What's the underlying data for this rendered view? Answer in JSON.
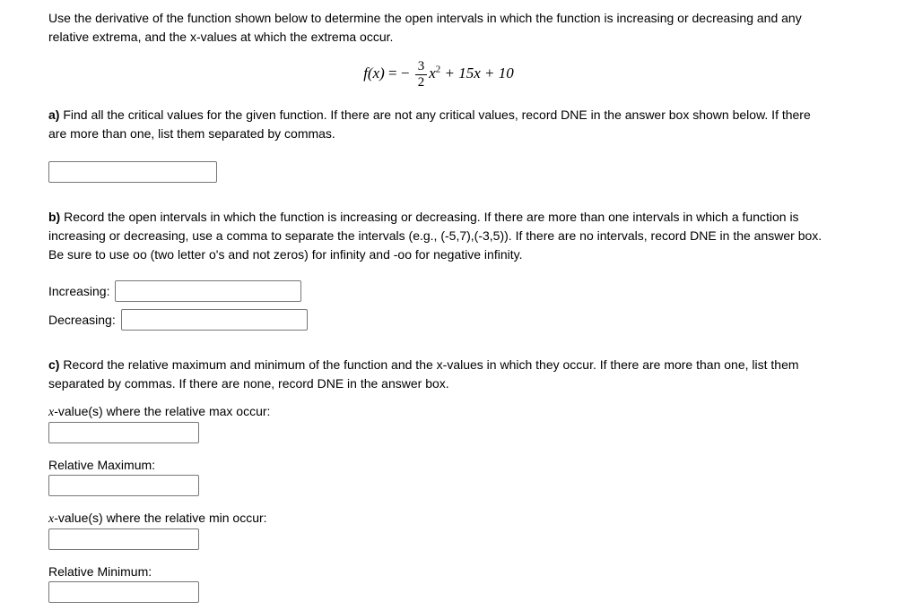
{
  "intro": "Use the derivative of the function shown below to determine the open intervals in which the function is increasing or decreasing and any relative extrema, and the x-values at which the extrema occur.",
  "formula": {
    "lhs": "f(x)",
    "equals": " = ",
    "minus": " − ",
    "frac_num": "3",
    "frac_den": "2",
    "x2": "x",
    "sup": "2",
    "tail": " + 15x + 10"
  },
  "parts": {
    "a": {
      "label": "a)",
      "text": " Find all the critical values for the given function. If there are not any critical values, record DNE in the answer box shown below. If there are more than one, list them separated by commas."
    },
    "b": {
      "label": "b)",
      "text": " Record the open intervals in which the function is increasing or decreasing. If there are more than one intervals in which a function is increasing or decreasing, use a comma to separate the intervals (e.g., (-5,7),(-3,5)). If there are no intervals, record DNE in the answer box. Be sure to use oo (two letter o's and not zeros) for infinity and -oo for negative infinity.",
      "increasing_label": "Increasing:",
      "decreasing_label": "Decreasing:"
    },
    "c": {
      "label": "c)",
      "text": " Record the relative maximum and minimum of the function and the x-values in which they occur. If there are more than one, list them separated by commas. If there are none, record DNE in the answer box.",
      "xmax_label_pre": "x",
      "xmax_label_post": "-value(s) where the relative max occur:",
      "relmax_label": "Relative Maximum:",
      "xmin_label_pre": "x",
      "xmin_label_post": "-value(s) where the relative min occur:",
      "relmin_label": "Relative Minimum:"
    }
  }
}
